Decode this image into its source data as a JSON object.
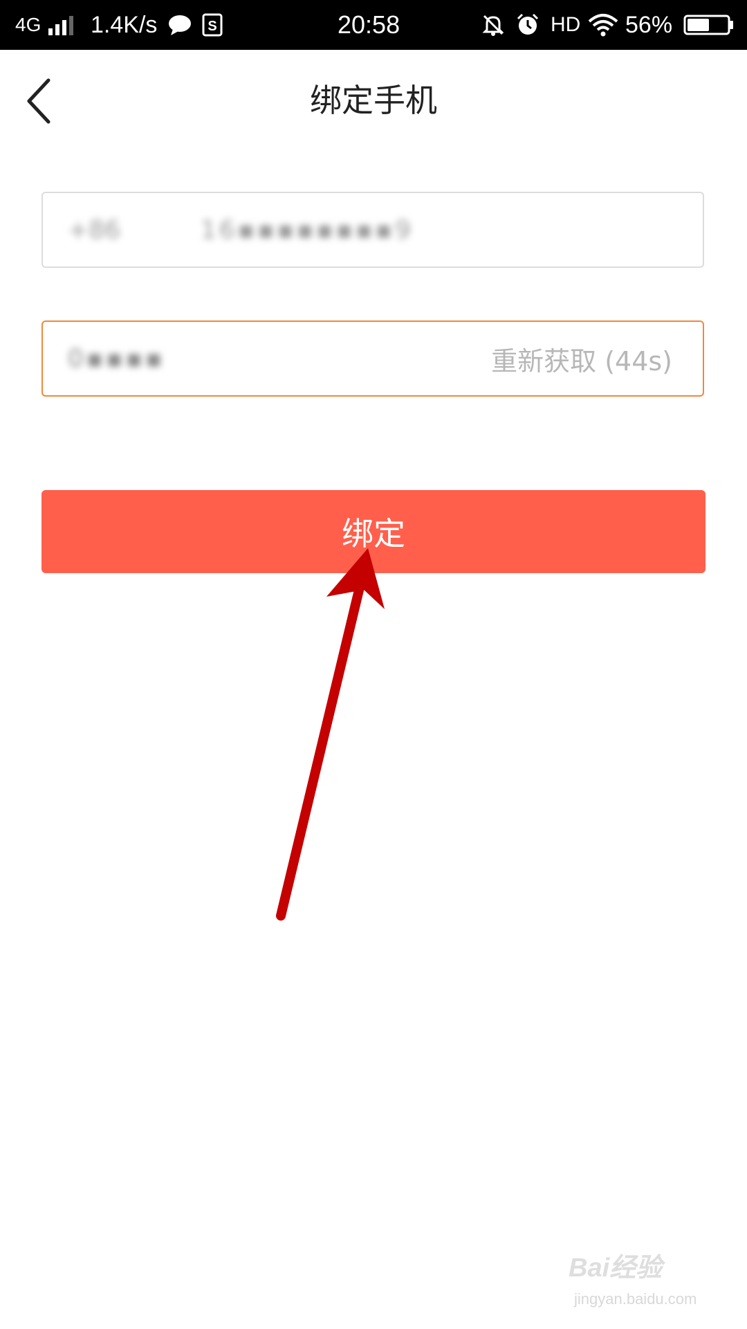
{
  "status_bar": {
    "network": "4G",
    "speed": "1.4K/s",
    "time": "20:58",
    "hd": "HD",
    "battery": "56%",
    "icons": [
      "signal-icon",
      "message-icon",
      "sim-icon",
      "bell-muted-icon",
      "alarm-icon",
      "wifi-icon",
      "battery-icon"
    ],
    "battery_level": 0.56
  },
  "header": {
    "title": "绑定手机",
    "back_icon": "chevron-left-icon"
  },
  "form": {
    "country_code": "+86",
    "phone_value": "16▪▪▪▪▪▪▪▪9",
    "code_value": "0▪▪▪▪",
    "resend_label": "重新获取 (44s)",
    "bind_label": "绑定"
  },
  "colors": {
    "accent": "#ff5f4b",
    "focus_border": "#f0883c",
    "annotation": "#c40000"
  },
  "watermark": {
    "main": "Bai经验",
    "sub": "jingyan.baidu.com"
  }
}
